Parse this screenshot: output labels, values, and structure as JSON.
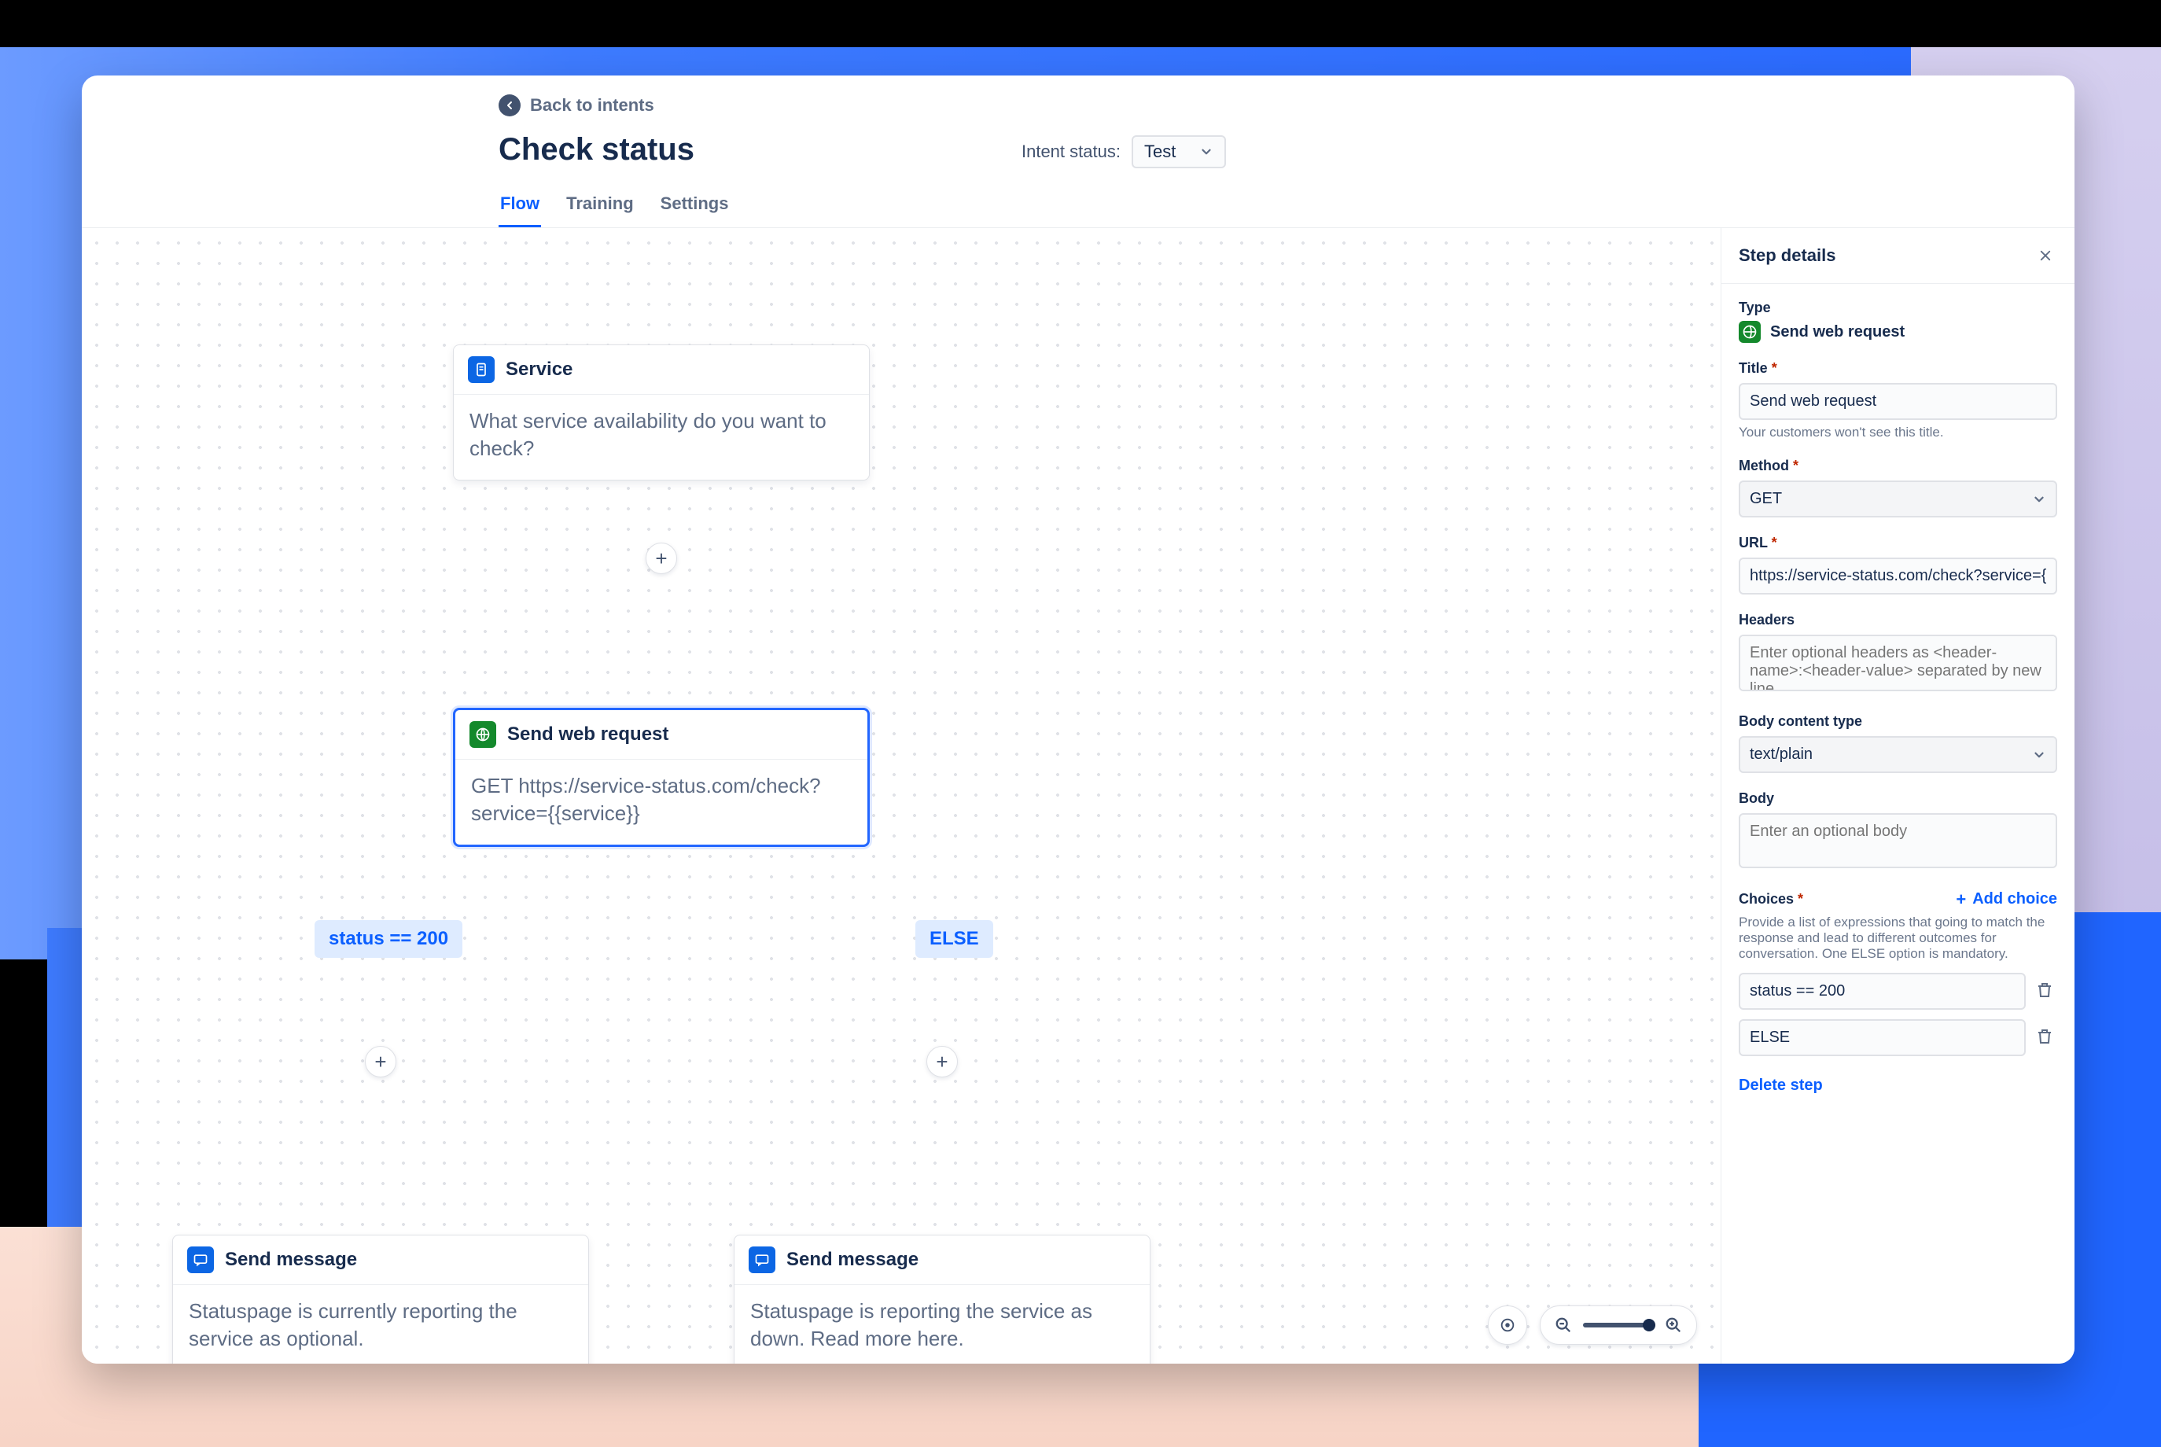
{
  "header": {
    "back_label": "Back to intents",
    "title": "Check status",
    "intent_status_label": "Intent status:",
    "intent_status_value": "Test",
    "tabs": {
      "flow": "Flow",
      "training": "Training",
      "settings": "Settings"
    }
  },
  "nodes": {
    "service": {
      "title": "Service",
      "body": "What service availability do you want to check?"
    },
    "web_request": {
      "title": "Send web request",
      "body": "GET https://service-status.com/check?service={{service}}"
    },
    "branch_left": "status == 200",
    "branch_right": "ELSE",
    "msg_left": {
      "title": "Send message",
      "body": "Statuspage is currently reporting the service as optional."
    },
    "msg_right": {
      "title": "Send message",
      "body": "Statuspage is reporting the service as down. Read more here."
    }
  },
  "panel": {
    "header": "Step details",
    "type_label": "Type",
    "type_value": "Send web request",
    "title_label": "Title",
    "title_value": "Send web request",
    "title_help": "Your customers won't see this title.",
    "method_label": "Method",
    "method_value": "GET",
    "url_label": "URL",
    "url_value": "https://service-status.com/check?service={{service}}",
    "headers_label": "Headers",
    "headers_placeholder": "Enter optional headers as <header-name>:<header-value> separated by new line",
    "body_type_label": "Body content type",
    "body_type_value": "text/plain",
    "body_label": "Body",
    "body_placeholder": "Enter an optional body",
    "choices_label": "Choices",
    "add_choice_label": "Add choice",
    "choices_help": "Provide a list of expressions that going to match the response and lead to different outcomes for conversation. One ELSE option is mandatory.",
    "choice1": "status == 200",
    "choice2": "ELSE",
    "delete_step": "Delete step"
  }
}
